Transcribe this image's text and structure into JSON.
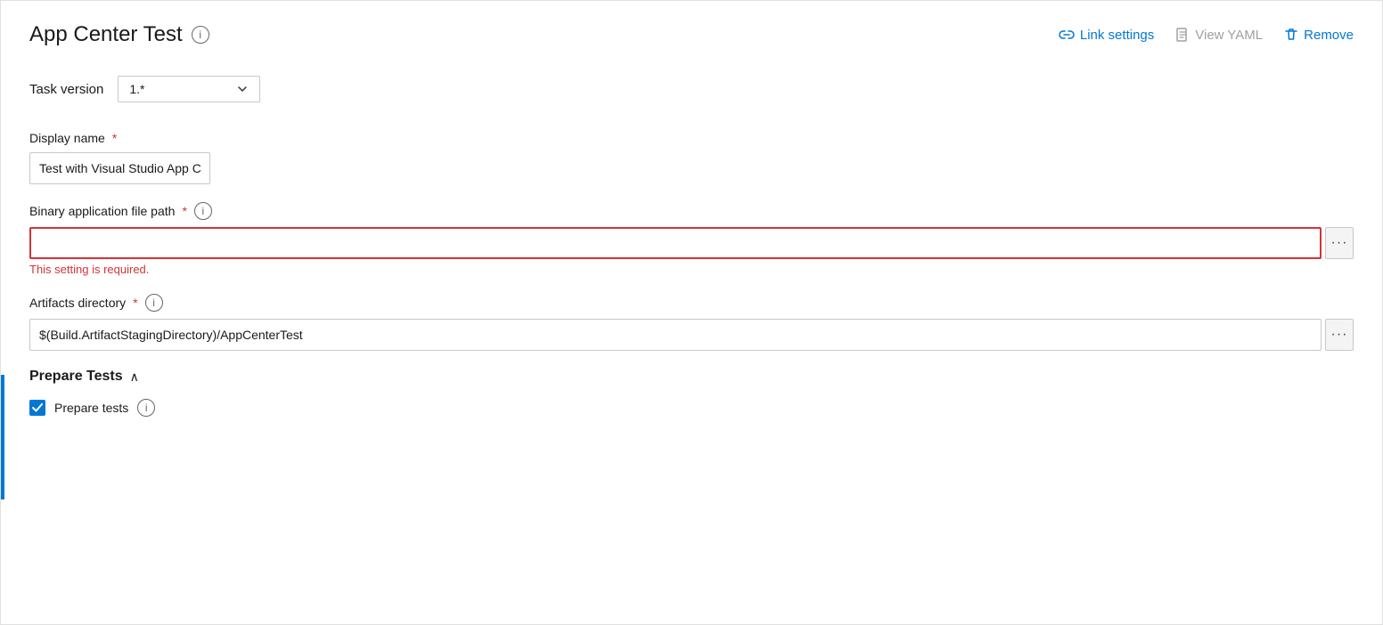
{
  "header": {
    "title": "App Center Test",
    "actions": {
      "link_settings": "Link settings",
      "view_yaml": "View YAML",
      "remove": "Remove"
    }
  },
  "task_version": {
    "label": "Task version",
    "value": "1.*"
  },
  "fields": {
    "display_name": {
      "label": "Display name",
      "required": true,
      "value": "Test with Visual Studio App Center",
      "placeholder": ""
    },
    "binary_path": {
      "label": "Binary application file path",
      "required": true,
      "value": "",
      "placeholder": "",
      "error": "This setting is required."
    },
    "artifacts_dir": {
      "label": "Artifacts directory",
      "required": true,
      "value": "$(Build.ArtifactStagingDirectory)/AppCenterTest",
      "placeholder": ""
    }
  },
  "prepare_tests": {
    "section_title": "Prepare Tests",
    "checkbox_label": "Prepare tests",
    "checkbox_checked": true
  },
  "icons": {
    "info": "i",
    "ellipsis": "···",
    "chevron_up": "∧",
    "check": "✓"
  }
}
